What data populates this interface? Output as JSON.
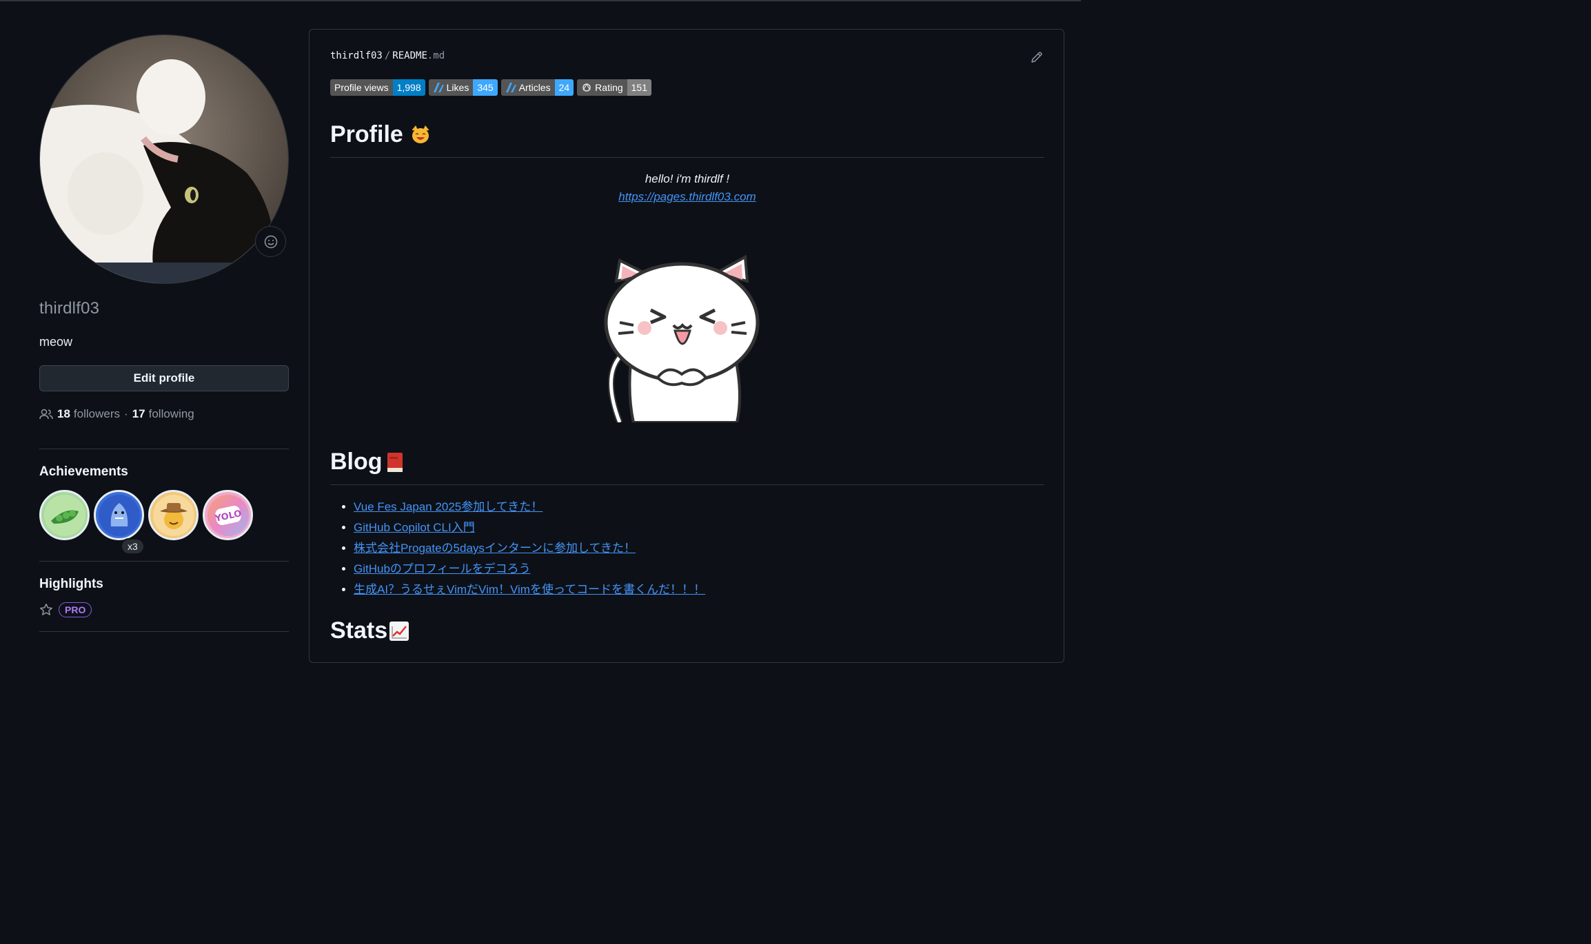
{
  "profile": {
    "username": "thirdlf03",
    "bio": "meow",
    "edit_label": "Edit profile",
    "followers_count": "18",
    "followers_label": "followers",
    "separator": "·",
    "following_count": "17",
    "following_label": "following"
  },
  "achievements": {
    "title": "Achievements",
    "badges": [
      {
        "name": "pair-extraordinaire",
        "icon": "peas-icon"
      },
      {
        "name": "pull-shark",
        "icon": "shark-icon",
        "count": "x3"
      },
      {
        "name": "quickdraw",
        "icon": "cowboy-icon"
      },
      {
        "name": "yolo",
        "icon": "yolo-icon"
      }
    ]
  },
  "highlights": {
    "title": "Highlights",
    "pro_label": "PRO"
  },
  "readme": {
    "owner": "thirdlf03",
    "sep": "/",
    "file": "README",
    "ext": ".md",
    "shields": [
      {
        "label": "Profile views",
        "value": "1,998",
        "color": "#007ec6"
      },
      {
        "label": "Likes",
        "value": "345",
        "color": "#3ea8ff"
      },
      {
        "label": "Articles",
        "value": "24",
        "color": "#3ea8ff"
      },
      {
        "label": "Rating",
        "value": "151",
        "color": "#808080"
      }
    ],
    "profile_heading": "Profile",
    "hello": "hello! i'm thirdlf !",
    "site_link": "https://pages.thirdlf03.com",
    "blog_heading": "Blog",
    "blog_posts": [
      "Vue Fes Japan 2025参加してきた！",
      "GitHub Copilot CLI入門",
      "株式会社Progateの5daysインターンに参加してきた！",
      "GitHubのプロフィールをデコろう",
      "生成AI？うるせぇVimだVim！Vimを使ってコードを書くんだ！！！"
    ],
    "stats_heading": "Stats"
  }
}
